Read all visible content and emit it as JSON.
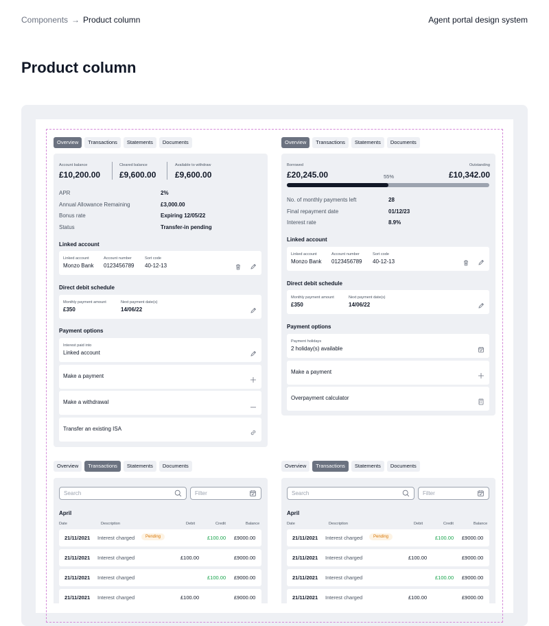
{
  "breadcrumb": {
    "parent": "Components",
    "separator": "→",
    "current": "Product column"
  },
  "brand": "Agent portal design system",
  "page_title": "Product column",
  "tabs": [
    "Overview",
    "Transactions",
    "Statements",
    "Documents"
  ],
  "savings": {
    "balances": [
      {
        "label": "Account balance",
        "value": "£10,200.00"
      },
      {
        "label": "Cleared balance",
        "value": "£9,600.00"
      },
      {
        "label": "Available to withdraw",
        "value": "£9,600.00"
      }
    ],
    "details": [
      {
        "label": "APR",
        "value": "2%"
      },
      {
        "label": "Annual Allowance Remaining",
        "value": "£3,000.00"
      },
      {
        "label": "Bonus rate",
        "value": "Expiring 12/05/22"
      },
      {
        "label": "Status",
        "value": "Transfer-in pending"
      }
    ],
    "linked_title": "Linked account",
    "linked": {
      "bank_label": "Linked account",
      "bank": "Monzo Bank",
      "acc_label": "Account number",
      "acc": "0123456789",
      "sort_label": "Sort code",
      "sort": "40-12-13"
    },
    "dd_title": "Direct debit schedule",
    "dd": {
      "amount_label": "Monthly payment amount",
      "amount": "£350",
      "next_label": "Next payment date(s)",
      "next": "14/06/22"
    },
    "payment_title": "Payment options",
    "interest": {
      "label": "Interest paid into",
      "value": "Linked account"
    },
    "actions": [
      "Make a payment",
      "Make a withdrawal",
      "Transfer an existing ISA"
    ]
  },
  "loan": {
    "borrowed_label": "Borrowed",
    "borrowed": "£20,245.00",
    "percent_label": "55%",
    "progress": 0.5,
    "outstanding_label": "Outstanding",
    "outstanding": "£10,342.00",
    "details": [
      {
        "label": "No. of monthly payments left",
        "value": "28"
      },
      {
        "label": "Final repayment date",
        "value": "01/12/23"
      },
      {
        "label": "Interest rate",
        "value": "8.9%"
      }
    ],
    "linked_title": "Linked account",
    "linked": {
      "bank_label": "Linked account",
      "bank": "Monzo Bank",
      "acc_label": "Account number",
      "acc": "0123456789",
      "sort_label": "Sort code",
      "sort": "40-12-13"
    },
    "dd_title": "Direct debit schedule",
    "dd": {
      "amount_label": "Monthly payment amount",
      "amount": "£350",
      "next_label": "Next payment date(s)",
      "next": "14/06/22"
    },
    "payment_title": "Payment options",
    "holidays": {
      "label": "Payment holidays",
      "value": "2 holiday(s) available"
    },
    "actions": [
      "Make a payment",
      "Overpayment calculator"
    ]
  },
  "transactions": {
    "search_placeholder": "Search",
    "filter_placeholder": "Filter",
    "month": "April",
    "headers": {
      "date": "Date",
      "description": "Description",
      "debit": "Debit",
      "credit": "Credit",
      "balance": "Balance"
    },
    "rows": [
      {
        "date": "21/11/2021",
        "description": "Interest charged",
        "status": "Pending",
        "debit": "",
        "credit": "£100.00",
        "balance": "£9000.00"
      },
      {
        "date": "21/11/2021",
        "description": "Interest charged",
        "status": "",
        "debit": "£100.00",
        "credit": "",
        "balance": "£9000.00"
      },
      {
        "date": "21/11/2021",
        "description": "Interest charged",
        "status": "",
        "debit": "",
        "credit": "£100.00",
        "balance": "£9000.00"
      },
      {
        "date": "21/11/2021",
        "description": "Interest charged",
        "status": "",
        "debit": "£100.00",
        "credit": "",
        "balance": "£9000.00"
      }
    ]
  },
  "colors": {
    "accent_tab": "#6b7280",
    "credit": "#16a34a",
    "pending": "#d97706",
    "dashed_frame": "#d58ad8"
  }
}
